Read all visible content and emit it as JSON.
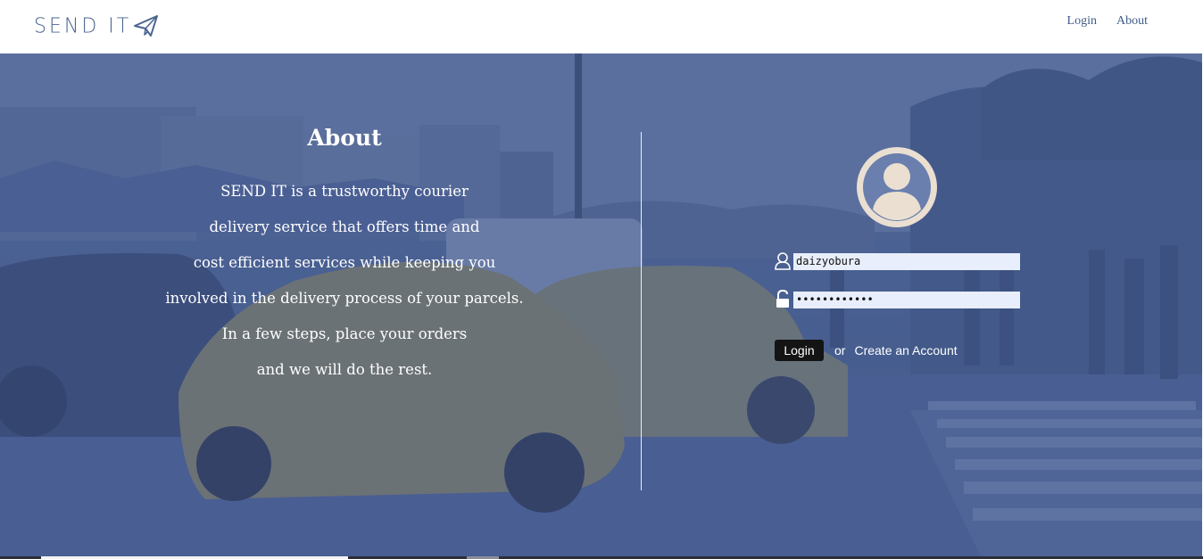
{
  "header": {
    "logo_text": "SEND IT",
    "logo_icon": "paper-plane-icon",
    "nav": [
      {
        "label": "Login"
      },
      {
        "label": "About"
      }
    ]
  },
  "about": {
    "title": "About",
    "lines": [
      "SEND IT is a trustworthy courier",
      "delivery service that offers time and",
      "cost efficient services while keeping you",
      "involved in the delivery process of your parcels.",
      "In a few steps, place your orders",
      "and we will do the rest."
    ]
  },
  "login": {
    "avatar_icon": "user-avatar-icon",
    "username_icon": "user-icon",
    "username_value": "daizyobura",
    "password_icon": "unlock-icon",
    "password_value": "••••••••••••",
    "login_button": "Login",
    "or_text": "or",
    "create_account_link": "Create an Account"
  },
  "colors": {
    "brand": "#4a6590",
    "overlay": "#3c558c",
    "avatar_bg": "#eadfd1",
    "input_bg": "#e8eefb",
    "button_bg": "#141414"
  }
}
